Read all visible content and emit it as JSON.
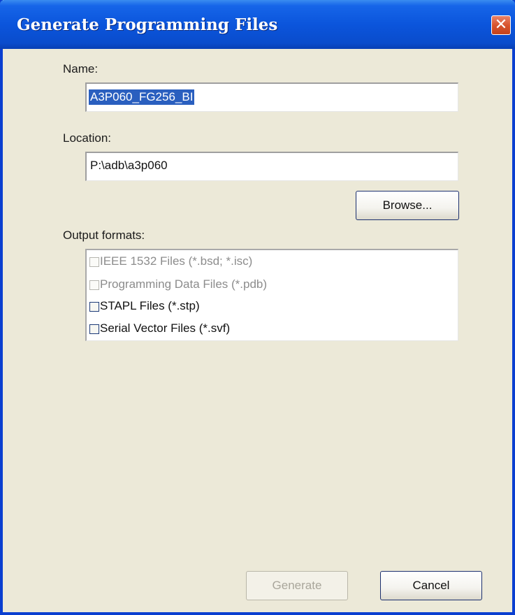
{
  "window": {
    "title": "Generate Programming Files",
    "close_symbol": "✕",
    "close_icon": "close-icon"
  },
  "name_field": {
    "label": "Name:",
    "value": "A3P060_FG256_BI",
    "selected": true
  },
  "location_field": {
    "label": "Location:",
    "value": "P:\\adb\\a3p060"
  },
  "browse_button": {
    "label": "Browse..."
  },
  "output_formats": {
    "label": "Output formats:",
    "items": [
      {
        "label": "IEEE 1532 Files (*.bsd; *.isc)",
        "checked": false,
        "enabled": false
      },
      {
        "label": "Programming Data Files (*.pdb)",
        "checked": false,
        "enabled": false
      },
      {
        "label": "STAPL Files (*.stp)",
        "checked": false,
        "enabled": true
      },
      {
        "label": "Serial Vector Files (*.svf)",
        "checked": false,
        "enabled": true
      }
    ]
  },
  "footer": {
    "generate_label": "Generate",
    "generate_enabled": false,
    "cancel_label": "Cancel"
  },
  "colors": {
    "titlebar": "#0b55dc",
    "dialog_bg": "#ece9d8",
    "selection": "#2a5fbf",
    "close_button": "#d8542e"
  }
}
